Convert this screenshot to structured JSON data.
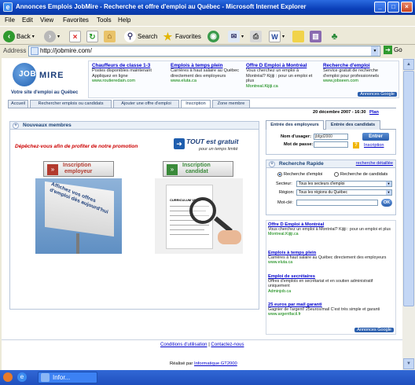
{
  "window": {
    "title": "Annonces Emplois JobMire - Recherche et offre d'emploi au Québec - Microsoft Internet Explorer",
    "icon": "ie-icon",
    "controls": [
      "_",
      "□",
      "×"
    ]
  },
  "menu": [
    "File",
    "Edit",
    "View",
    "Favorites",
    "Tools",
    "Help"
  ],
  "toolbar": {
    "back": "Back",
    "search": "Search",
    "favorites": "Favorites"
  },
  "address": {
    "label": "Address",
    "url": "http://jobmire.com/",
    "go": "Go"
  },
  "site": {
    "logo_text": "MIRE",
    "logo_prefix": "JOB",
    "tagline": "Votre site d'emploi au Québec",
    "top_ads": [
      {
        "title": "Chauffeurs de classe 1-3",
        "body": "Postes disponibles maintenant Appliquez en ligne",
        "url": "www.routieredain.com"
      },
      {
        "title": "Emplois à temps plein",
        "body": "Carrières à haut salaire au Québec directement des employeurs",
        "url": "www.eluta.ca"
      },
      {
        "title": "Offre D Emploi à Montréal",
        "body": "Vous cherchez un emploi à Montréal? Kijiji : pour un emploi et plus",
        "url": "Montreal.Kijiji.ca"
      },
      {
        "title": "Recherche d'emploi",
        "body": "Service gratuit de recherche d'emploi pour professionnels",
        "url": "www.jobseen.com"
      }
    ],
    "ads_by": "Annonces Google",
    "nav_tabs": [
      "Accueil",
      "Rechercher emplois ou candidats",
      "Ajouter une offre d'emploi",
      "Inscription",
      "Zone membre"
    ],
    "date": "20 décembre 2007 - 16:30",
    "plan": "Plan",
    "new_members": {
      "header": "Nouveaux membres",
      "promo_text": "Dépêchez-vous afin de profiter de notre promotion",
      "free_title": "TOUT est gratuit",
      "free_sub": "pour un temps limité",
      "btn_employer_line1": "Inscription",
      "btn_employer_line2": "employeur",
      "btn_candidate_line1": "Inscription",
      "btn_candidate_line2": "candidat",
      "billboard_text": "Affichez vos offres d'emploi dès aujourd'hui",
      "cv_heading": "CURRICULUM VITAE"
    },
    "login": {
      "tab_employers": "Entrée des employeurs",
      "tab_candidates": "Entrée des candidats",
      "username_label": "Nom d'usager:",
      "username_value": "jbfgd2000",
      "password_label": "Mot de passe:",
      "enter_button": "Entrer",
      "signup_link": "Inscription",
      "help": "?"
    },
    "quick_search": {
      "header": "Recherche Rapide",
      "advanced_link": "recherche détaillée",
      "radio_jobs": "Recherche d'emploi",
      "radio_candidates": "Recherche de candidats",
      "sector_label": "Secteur:",
      "sector_value": "Tous les secteurs d'emploi",
      "region_label": "Région:",
      "region_value": "Tous les régions du Québec",
      "keyword_label": "Mot-clé:",
      "ok_button": "OK"
    },
    "side_ads": [
      {
        "title": "Offre D Emploi à Montréal",
        "body": "Vous cherchez un emploi à Montréal? Kijiji : pour un emploi et plus",
        "url": "Montreal.Kijiji.ca"
      },
      {
        "title": "Emplois à temps plein",
        "body": "Carrières à haut salaire au Québec directement des employeurs",
        "url": "www.eluta.ca"
      },
      {
        "title": "Emploi de secrétaires",
        "body": "Offres d'emplois en secrétariat et en soutien administratif uniquement",
        "url": "Adminjob.ca"
      },
      {
        "title": "25 euros par mail garanti",
        "body": "Gagnier de l'argent! 25euros/mail C'est très simple et garanti",
        "url": "www.argentfacil.fr"
      }
    ],
    "footer": {
      "terms": "Conditions d'utilisation",
      "sep": "|",
      "contact": "Contactez-nous",
      "made_by": "Réalisé par",
      "made_by_link": "Informatique GT2000"
    }
  },
  "status": {
    "taskbar_item": "Infor..."
  },
  "colors": {
    "title_bar": "#0A3FB8",
    "link": "#0000cc",
    "promo_red": "#cc0000",
    "button_red": "#b23a2e",
    "button_green": "#3a8a3a"
  }
}
